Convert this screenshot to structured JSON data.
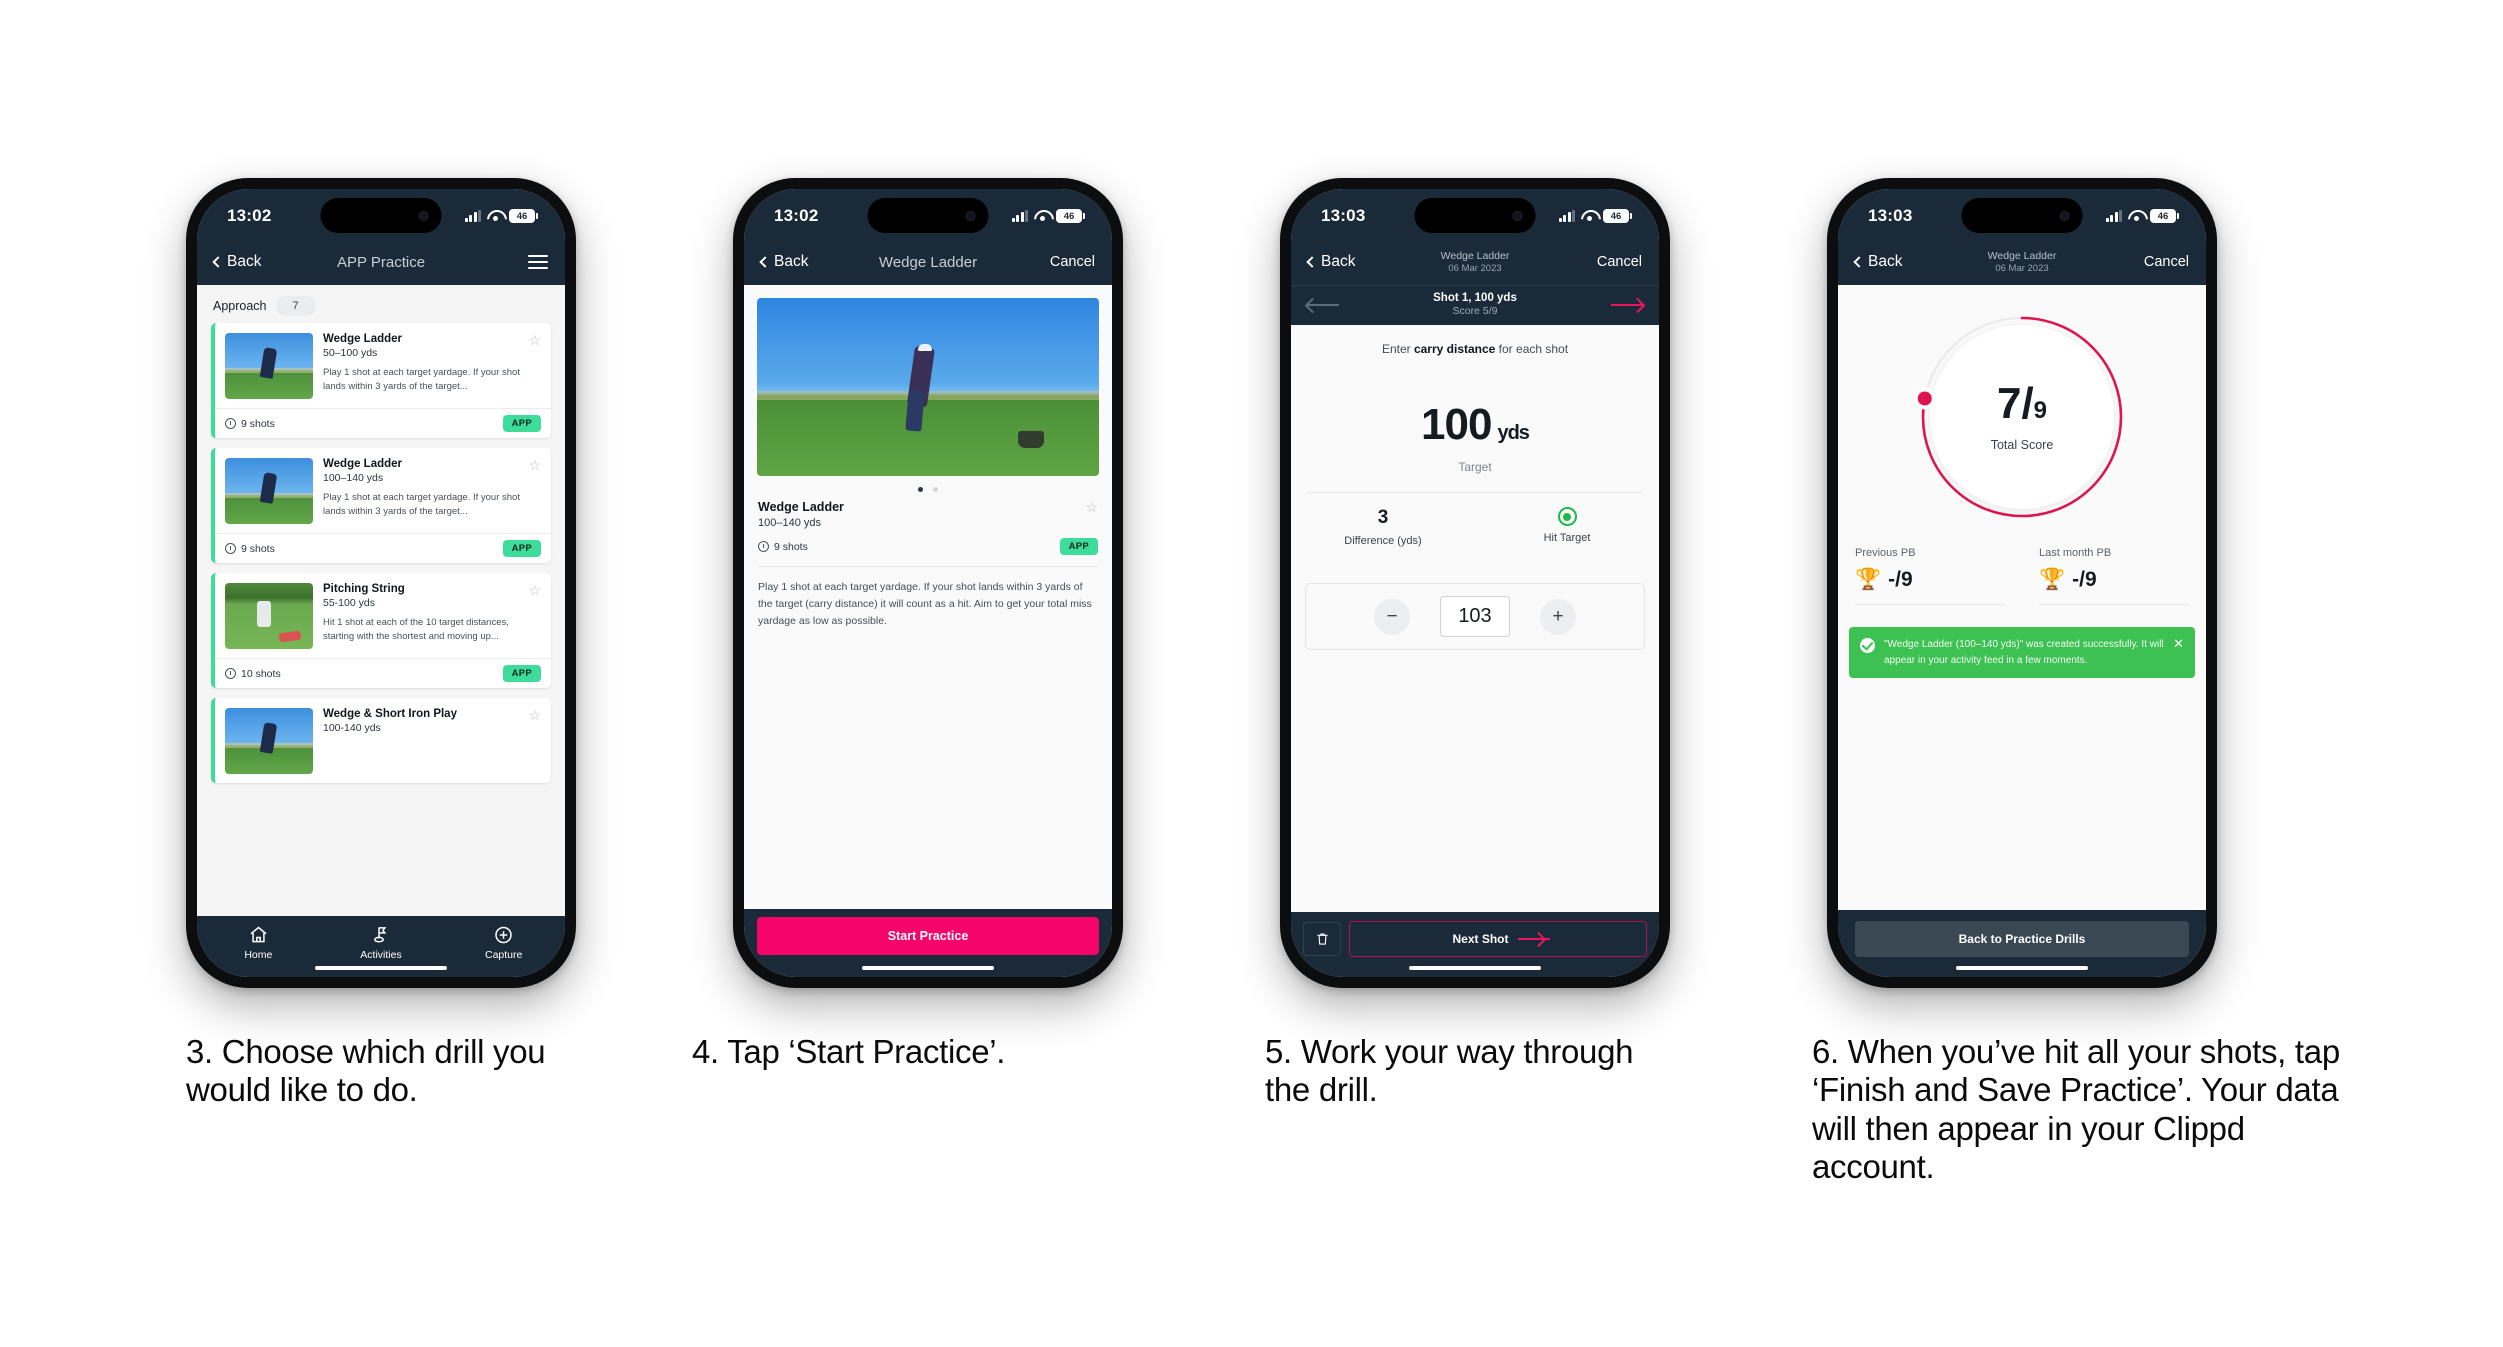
{
  "phone1": {
    "status": {
      "time": "13:02",
      "battery": "46"
    },
    "nav": {
      "back": "Back",
      "title": "APP Practice",
      "menu_icon": "hamburger-icon"
    },
    "filter": {
      "label": "Approach",
      "count": "7"
    },
    "drills": [
      {
        "title": "Wedge Ladder",
        "range": "50–100 yds",
        "desc": "Play 1 shot at each target yardage. If your shot lands within 3 yards of the target...",
        "shots": "9 shots",
        "badge": "APP"
      },
      {
        "title": "Wedge Ladder",
        "range": "100–140 yds",
        "desc": "Play 1 shot at each target yardage. If your shot lands within 3 yards of the target...",
        "shots": "9 shots",
        "badge": "APP"
      },
      {
        "title": "Pitching String",
        "range": "55-100 yds",
        "desc": "Hit 1 shot at each of the 10 target distances, starting with the shortest and moving up...",
        "shots": "10 shots",
        "badge": "APP"
      },
      {
        "title": "Wedge & Short Iron Play",
        "range": "100-140 yds",
        "desc": "",
        "shots": "",
        "badge": ""
      }
    ],
    "tabs": [
      {
        "label": "Home",
        "icon": "home-icon"
      },
      {
        "label": "Activities",
        "icon": "golf-flag-icon"
      },
      {
        "label": "Capture",
        "icon": "plus-circle-icon"
      }
    ]
  },
  "phone2": {
    "status": {
      "time": "13:02",
      "battery": "46"
    },
    "nav": {
      "back": "Back",
      "title": "Wedge Ladder",
      "cancel": "Cancel"
    },
    "detail": {
      "title": "Wedge Ladder",
      "range": "100–140 yds",
      "shots": "9 shots",
      "badge": "APP",
      "description": "Play 1 shot at each target yardage. If your shot lands within 3 yards of the target (carry distance) it will count as a hit. Aim to get your total miss yardage as low as possible."
    },
    "cta": "Start Practice"
  },
  "phone3": {
    "status": {
      "time": "13:03",
      "battery": "46"
    },
    "nav": {
      "back": "Back",
      "title": "Wedge Ladder",
      "subtitle": "06 Mar 2023",
      "cancel": "Cancel"
    },
    "shotbar": {
      "title": "Shot 1, 100 yds",
      "score": "Score 5/9"
    },
    "hint_pre": "Enter ",
    "hint_bold": "carry distance",
    "hint_post": " for each shot",
    "target": {
      "value": "100",
      "unit": "yds",
      "label": "Target"
    },
    "stats": [
      {
        "value": "3",
        "label": "Difference (yds)"
      },
      {
        "value": "",
        "label": "Hit Target"
      }
    ],
    "stepper": {
      "minus": "−",
      "value": "103",
      "plus": "+"
    },
    "footer": {
      "delete_icon": "trash-icon",
      "next": "Next Shot"
    }
  },
  "phone4": {
    "status": {
      "time": "13:03",
      "battery": "46"
    },
    "nav": {
      "back": "Back",
      "title": "Wedge Ladder",
      "subtitle": "06 Mar 2023",
      "cancel": "Cancel"
    },
    "ring": {
      "numerator": "7",
      "slash": "/",
      "denominator": "9",
      "label": "Total Score",
      "percent": 78
    },
    "pbs": [
      {
        "label": "Previous PB",
        "value": "-/9",
        "icon": "trophy-icon"
      },
      {
        "label": "Last month PB",
        "value": "-/9",
        "icon": "trophy-icon"
      }
    ],
    "toast": {
      "message": "\"Wedge Ladder (100–140 yds)\" was created successfully. It will appear in your activity feed in a few moments.",
      "close_icon": "close-icon"
    },
    "back_button": "Back to Practice Drills"
  },
  "captions": [
    "3. Choose which drill you would like to do.",
    "4. Tap ‘Start Practice’.",
    "5. Work your way through the drill.",
    "6. When you’ve hit all your shots, tap ‘Finish and Save Practice’. Your data will then appear in your Clippd account."
  ],
  "colors": {
    "header_navy": "#1b2a38",
    "accent_mint": "#3ddc9a",
    "accent_pink": "#f5046c",
    "ring_pink": "#e0144e",
    "toast_green": "#3cc152"
  }
}
